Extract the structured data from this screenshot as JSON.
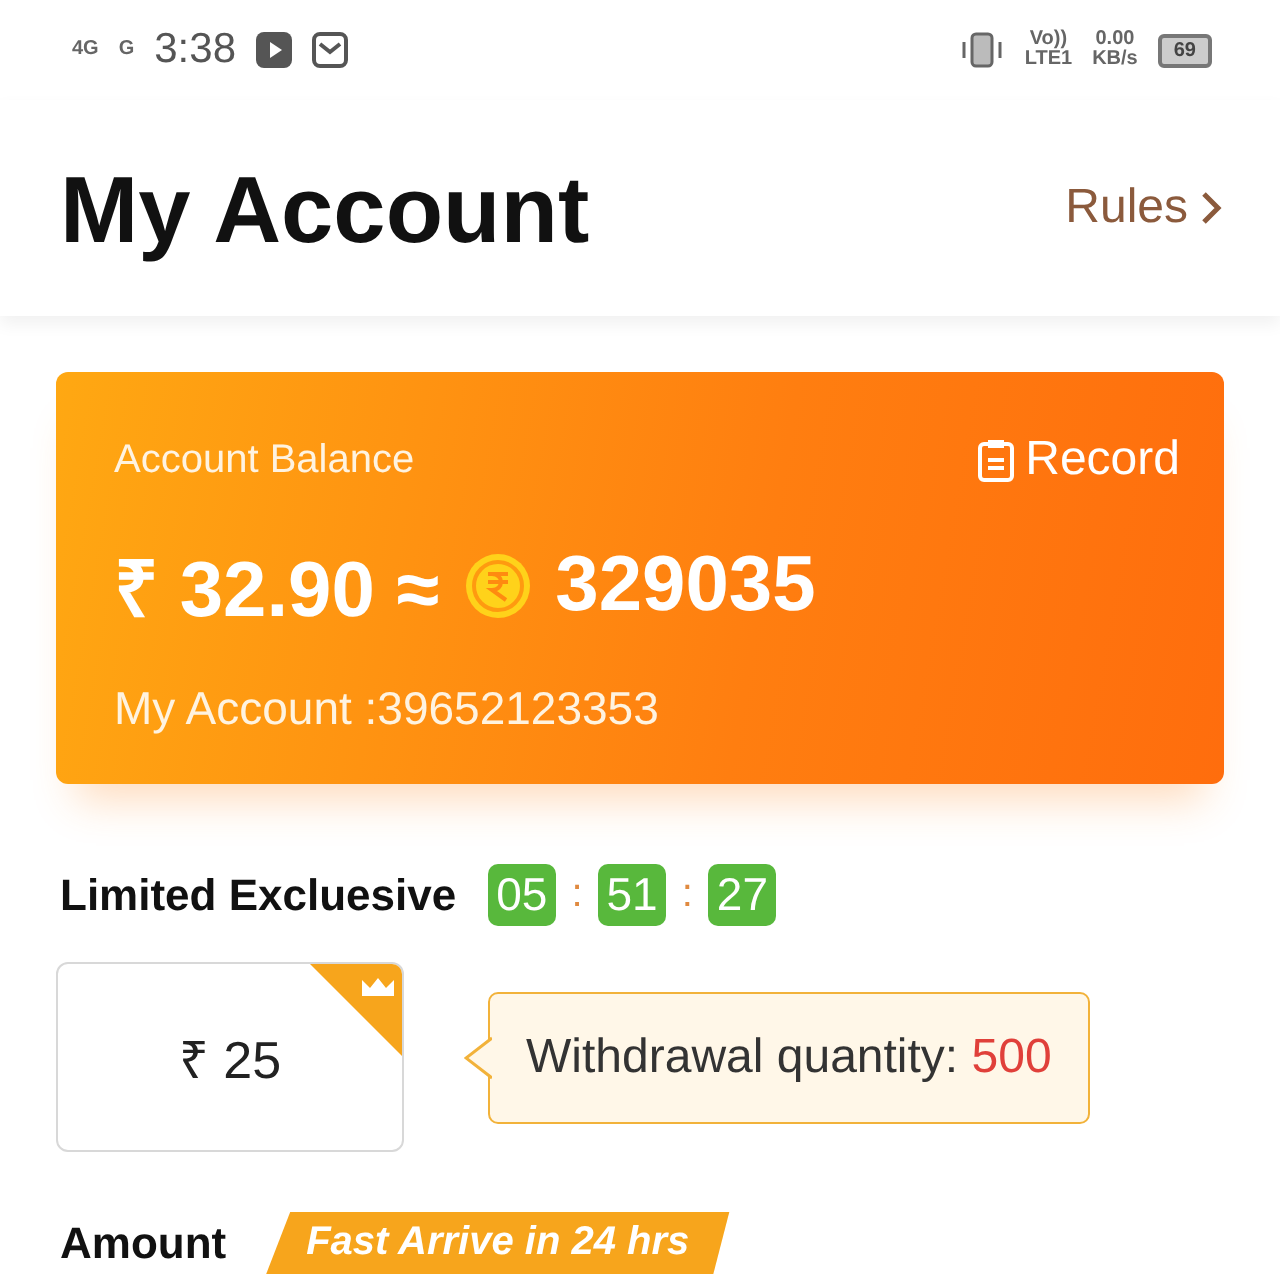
{
  "status_bar": {
    "network_1": "4G",
    "network_2": "G",
    "time": "3:38",
    "volte": "Vo))",
    "lte": "LTE1",
    "speed": "0.00",
    "speed_unit": "KB/s",
    "battery": "69"
  },
  "header": {
    "title": "My Account",
    "rules_link": "Rules"
  },
  "balance_card": {
    "label": "Account Balance",
    "record_button": "Record",
    "rupees": "₹ 32.90 ≈",
    "coins": "329035",
    "account": "My Account :39652123353"
  },
  "limited": {
    "title": "Limited Excluesive",
    "timer": [
      "05",
      "51",
      "27"
    ],
    "separator": ":"
  },
  "options": [
    {
      "amount": "₹ 25",
      "selected": true
    }
  ],
  "bubble": {
    "label": "Withdrawal quantity:",
    "quantity": "500"
  },
  "amount_section": {
    "title": "Amount",
    "badge": "Fast Arrive in 24 hrs"
  }
}
